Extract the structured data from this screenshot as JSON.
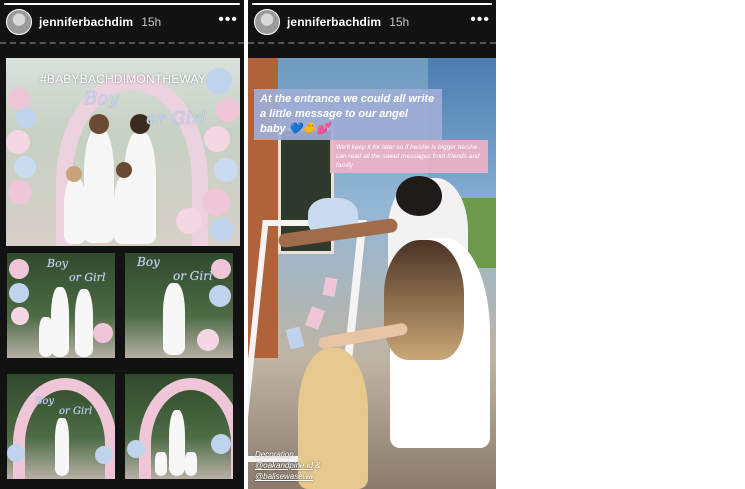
{
  "stories": [
    {
      "username": "jenniferbachdim",
      "timestamp": "15h",
      "more_icon": "more-horizontal-icon",
      "progress": 1.0,
      "hashtag": "#BABYBACHDIMONTHEWAY",
      "sign_boy": "Boy",
      "sign_or_girl": "or Girl",
      "thumb_sign_boy": "Boy",
      "thumb_sign_or_girl": "or Girl"
    },
    {
      "username": "jenniferbachdim",
      "timestamp": "15h",
      "more_icon": "more-horizontal-icon",
      "progress": 1.0,
      "caption": "At the entrance we could all write a little message to our angel baby 💙🐥💕",
      "note": "We'll keep it for later so if he/she is bigger he/she can read all the sweet messages from friends and family",
      "credit_label": "Decoration",
      "credit_mention_1": "@oakandpine.id",
      "credit_amp": "&",
      "credit_mention_2": "@balisewasewa"
    }
  ],
  "colors": {
    "story_bg": "#121212",
    "caption_bg": "#9eacd6",
    "note_bg": "#ecb1c6",
    "balloon_pink": "#efc6d8",
    "balloon_blue": "#bfd3ec"
  }
}
